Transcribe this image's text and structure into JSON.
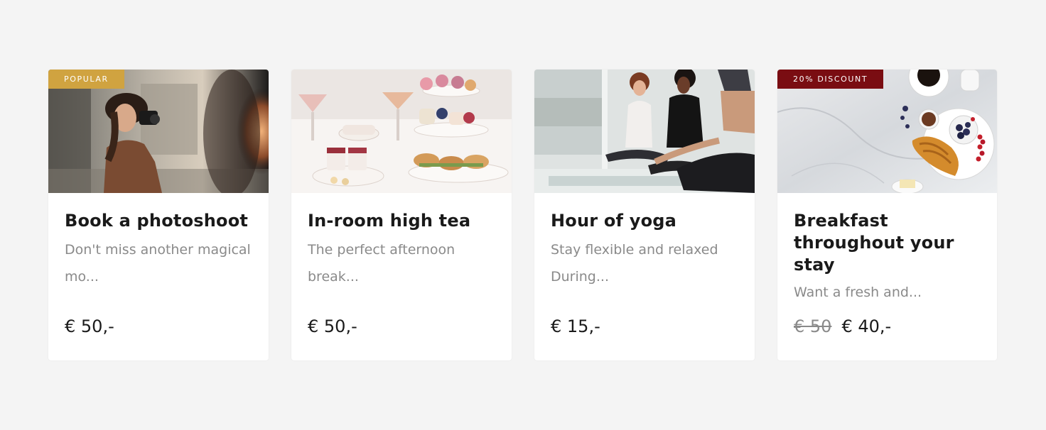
{
  "cards": [
    {
      "badge": "POPULAR",
      "title": "Book a photoshoot",
      "description": "Don't miss another magical mo...",
      "price": "€ 50,-",
      "image_icon": "photographer-image",
      "badge_color": "#d0a340"
    },
    {
      "badge": "",
      "title": "In-room high tea",
      "description": "The perfect afternoon break...",
      "price": "€ 50,-",
      "image_icon": "high-tea-image"
    },
    {
      "badge": "",
      "title": "Hour of yoga",
      "description": "Stay flexible and relaxed During...",
      "price": "€ 15,-",
      "image_icon": "yoga-image"
    },
    {
      "badge": "20% DISCOUNT",
      "title": "Breakfast throughout your stay",
      "description": "Want a fresh and...",
      "old_price": "€ 50",
      "price": "€ 40,-",
      "image_icon": "breakfast-image",
      "badge_color": "#7a0d12"
    }
  ],
  "colors": {
    "background": "#f4f4f4",
    "card": "#ffffff",
    "title": "#1a1a1a",
    "description": "#8a8a8a"
  }
}
